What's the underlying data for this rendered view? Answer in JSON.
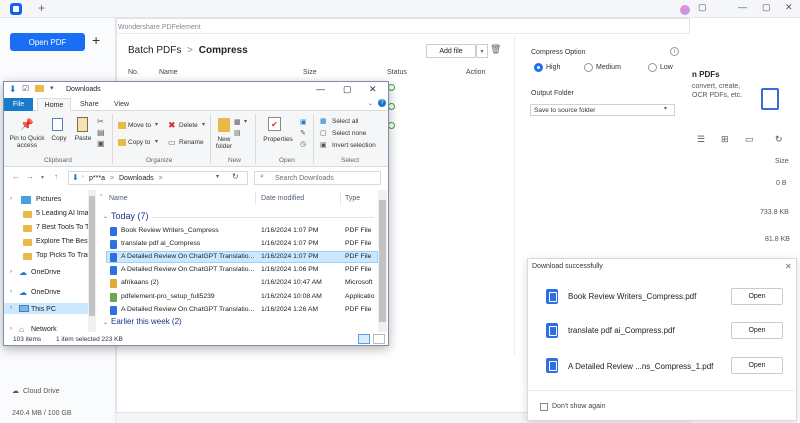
{
  "pdfelement": {
    "open_pdf": "Open PDF",
    "plus": "+",
    "new_tab": "+",
    "cloud_drive": "Cloud Drive",
    "storage": "240.4 MB / 100 GB",
    "window_controls": [
      "▢",
      "—",
      "▢",
      "✕"
    ]
  },
  "right_panel": {
    "title": "n PDFs",
    "description": "convert, create, OCR PDFs, etc.",
    "size_header": "Size",
    "sizes": [
      "0 B",
      "733.8 KB",
      "81.8 KB"
    ]
  },
  "batch": {
    "app_title": "Wondershare PDFelement",
    "breadcrumb_root": "Batch PDFs",
    "breadcrumb_sep": ">",
    "breadcrumb_current": "Compress",
    "add_file": "Add file",
    "columns": [
      "No.",
      "Name",
      "Size",
      "Status",
      "Action"
    ]
  },
  "compress_options": {
    "title": "Compress Option",
    "levels": [
      {
        "label": "High",
        "selected": true
      },
      {
        "label": "Medium",
        "selected": false
      },
      {
        "label": "Low",
        "selected": false
      }
    ],
    "output_folder_label": "Output Folder",
    "output_folder_value": "Save to source folder"
  },
  "download_popup": {
    "title": "Download successfully",
    "files": [
      {
        "name": "Book Review Writers_Compress.pdf",
        "action": "Open"
      },
      {
        "name": "translate pdf ai_Compress.pdf",
        "action": "Open"
      },
      {
        "name": "A Detailed Review ...ns_Compress_1.pdf",
        "action": "Open"
      }
    ],
    "dont_show": "Don't show again"
  },
  "explorer": {
    "title": "Downloads",
    "tabs": [
      "File",
      "Home",
      "Share",
      "View"
    ],
    "ribbon": {
      "pin": "Pin to Quick access",
      "copy": "Copy",
      "paste": "Paste",
      "move_to": "Move to",
      "copy_to": "Copy to",
      "delete": "Delete",
      "rename": "Rename",
      "new_folder": "New folder",
      "properties": "Properties",
      "select_all": "Select all",
      "select_none": "Select none",
      "invert_selection": "Invert selection",
      "groups": [
        "Clipboard",
        "Organize",
        "New",
        "Open",
        "Select"
      ]
    },
    "address": {
      "user": "p***a",
      "sep": ">",
      "folder": "Downloads",
      "search_placeholder": "Search Downloads"
    },
    "nav": [
      "Pictures",
      "5 Leading AI Ima",
      "7 Best Tools To T",
      "Explore The Best",
      "Top Picks To Trar",
      "OneDrive",
      "OneDrive",
      "This PC",
      "Network"
    ],
    "columns": [
      "Name",
      "Date modified",
      "Type"
    ],
    "group_today": "Today (7)",
    "group_earlier": "Earlier this week (2)",
    "files": [
      {
        "name": "Book Review Writers_Compress",
        "date": "1/16/2024 1:07 PM",
        "type": "PDF File",
        "kind": "pdf"
      },
      {
        "name": "translate pdf ai_Compress",
        "date": "1/16/2024 1:07 PM",
        "type": "PDF File",
        "kind": "pdf"
      },
      {
        "name": "A Detailed Review On ChatGPT Translatio...",
        "date": "1/16/2024 1:07 PM",
        "type": "PDF File",
        "kind": "pdf"
      },
      {
        "name": "A Detailed Review On ChatGPT Translatio...",
        "date": "1/16/2024 1:06 PM",
        "type": "PDF File",
        "kind": "pdf"
      },
      {
        "name": "afrikaans (2)",
        "date": "1/16/2024 10:47 AM",
        "type": "Microsoft",
        "kind": "zip"
      },
      {
        "name": "pdfelement-pro_setup_full5239",
        "date": "1/16/2024 10:08 AM",
        "type": "Applicatio",
        "kind": "app"
      },
      {
        "name": "A Detailed Review On ChatGPT Translatio...",
        "date": "1/16/2024 1:26 AM",
        "type": "PDF File",
        "kind": "pdf"
      }
    ],
    "status_items": "103 items",
    "status_selected": "1 item selected  223 KB"
  },
  "colors": {
    "accent": "#1a6ef5",
    "explorer_file_tab": "#1979ca",
    "selection": "#cce8ff"
  }
}
